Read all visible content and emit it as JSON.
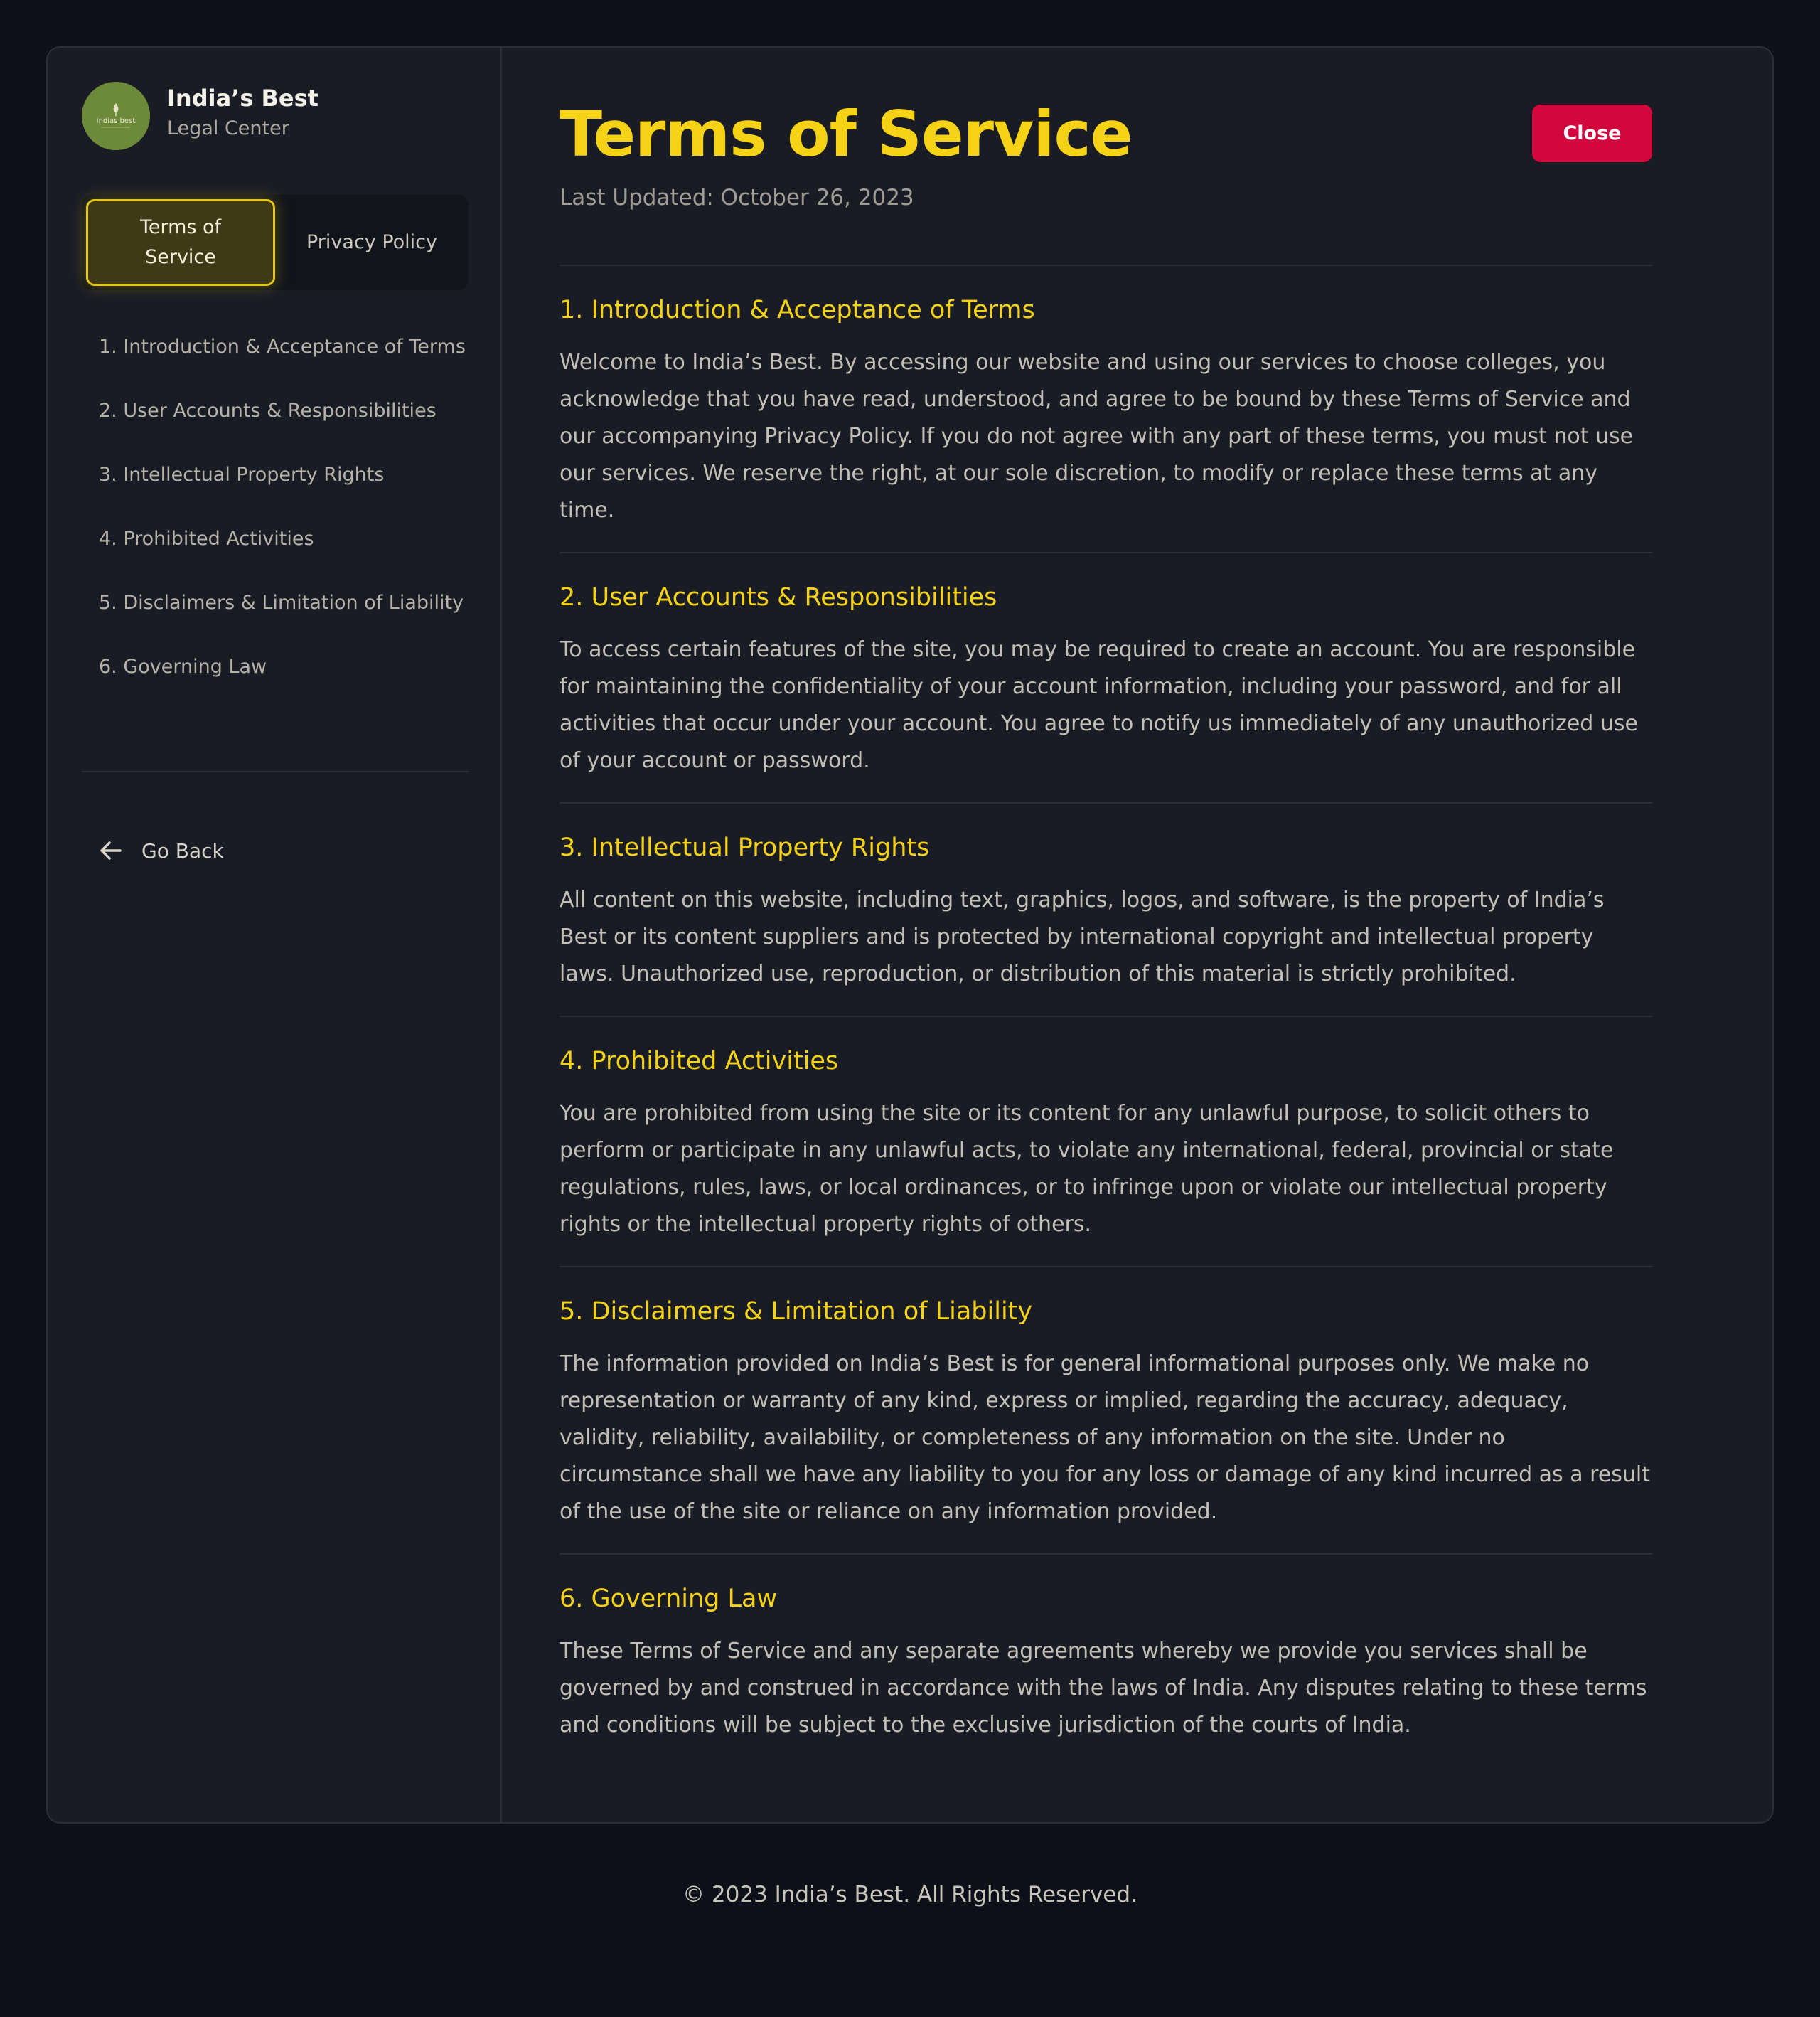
{
  "brand": {
    "name": "India’s Best",
    "subtitle": "Legal Center",
    "logo_text": "indias best"
  },
  "tabs": [
    {
      "label": "Terms of Service",
      "active": true
    },
    {
      "label": "Privacy Policy",
      "active": false
    }
  ],
  "toc": [
    "1. Introduction & Acceptance of Terms",
    "2. User Accounts & Responsibilities",
    "3. Intellectual Property Rights",
    "4. Prohibited Activities",
    "5. Disclaimers & Limitation of Liability",
    "6. Governing Law"
  ],
  "go_back": "Go Back",
  "page": {
    "title": "Terms of Service",
    "updated": "Last Updated: October 26, 2023",
    "close_label": "Close"
  },
  "sections": [
    {
      "title": "1. Introduction & Acceptance of Terms",
      "body": "Welcome to India’s Best. By accessing our website and using our services to choose colleges, you acknowledge that you have read, understood, and agree to be bound by these Terms of Service and our accompanying Privacy Policy. If you do not agree with any part of these terms, you must not use our services. We reserve the right, at our sole discretion, to modify or replace these terms at any time."
    },
    {
      "title": "2. User Accounts & Responsibilities",
      "body": "To access certain features of the site, you may be required to create an account. You are responsible for maintaining the confidentiality of your account information, including your password, and for all activities that occur under your account. You agree to notify us immediately of any unauthorized use of your account or password."
    },
    {
      "title": "3. Intellectual Property Rights",
      "body": "All content on this website, including text, graphics, logos, and software, is the property of India’s Best or its content suppliers and is protected by international copyright and intellectual property laws. Unauthorized use, reproduction, or distribution of this material is strictly prohibited."
    },
    {
      "title": "4. Prohibited Activities",
      "body": "You are prohibited from using the site or its content for any unlawful purpose, to solicit others to perform or participate in any unlawful acts, to violate any international, federal, provincial or state regulations, rules, laws, or local ordinances, or to infringe upon or violate our intellectual property rights or the intellectual property rights of others."
    },
    {
      "title": "5. Disclaimers & Limitation of Liability",
      "body": "The information provided on India’s Best is for general informational purposes only. We make no representation or warranty of any kind, express or implied, regarding the accuracy, adequacy, validity, reliability, availability, or completeness of any information on the site. Under no circumstance shall we have any liability to you for any loss or damage of any kind incurred as a result of the use of the site or reliance on any information provided."
    },
    {
      "title": "6. Governing Law",
      "body": "These Terms of Service and any separate agreements whereby we provide you services shall be governed by and construed in accordance with the laws of India. Any disputes relating to these terms and conditions will be subject to the exclusive jurisdiction of the courts of India."
    }
  ],
  "footer": "© 2023 India’s Best. All Rights Reserved.",
  "colors": {
    "page_bg": "#0d1018",
    "card_bg": "#1a1c25",
    "accent_yellow": "#f5d216",
    "close_red": "#d1073d",
    "logo_green": "#6c8a3a"
  }
}
